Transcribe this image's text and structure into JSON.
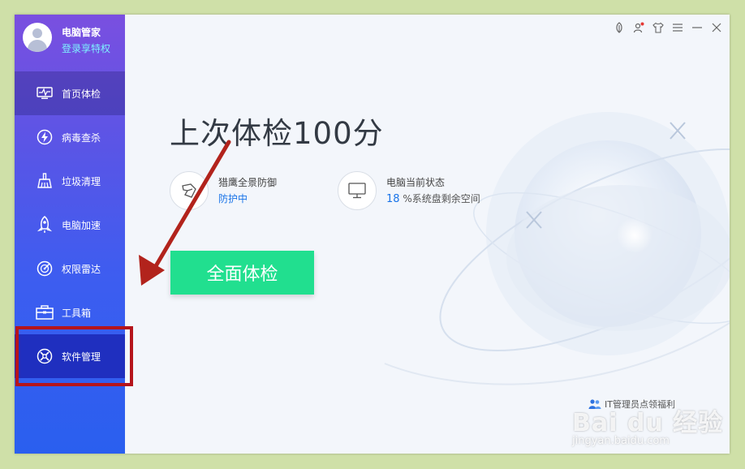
{
  "sidebar": {
    "app_name": "电脑管家",
    "login_link": "登录享特权",
    "items": [
      {
        "label": "首页体检",
        "icon": "monitor-pulse-icon"
      },
      {
        "label": "病毒查杀",
        "icon": "lightning-shield-icon"
      },
      {
        "label": "垃圾清理",
        "icon": "broom-icon"
      },
      {
        "label": "电脑加速",
        "icon": "rocket-icon"
      },
      {
        "label": "权限雷达",
        "icon": "radar-icon"
      },
      {
        "label": "工具箱",
        "icon": "toolbox-icon"
      },
      {
        "label": "软件管理",
        "icon": "software-manager-icon"
      }
    ]
  },
  "main": {
    "score_text": "上次体检100分",
    "cards": [
      {
        "title": "猎鹰全景防御",
        "value": "防护中"
      },
      {
        "title": "电脑当前状态",
        "value_num": "18",
        "value_rest": " %系统盘剩余空间"
      }
    ],
    "scan_button": "全面体检",
    "promo": "IT管理员点领福利"
  },
  "watermark": {
    "main": "Bai du 经验",
    "sub": "jingyan.baidu.com"
  },
  "colors": {
    "accent_green": "#21df8f",
    "link_blue": "#1a74e8",
    "highlight_red": "#b5141b",
    "sidebar_top": "#7a4fe0",
    "sidebar_bottom": "#2a5fef"
  }
}
